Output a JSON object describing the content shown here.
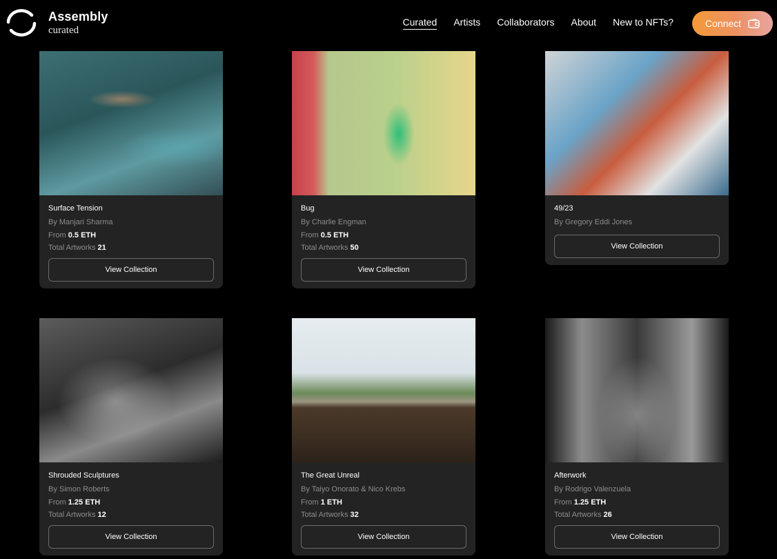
{
  "header": {
    "brand_title": "Assembly",
    "brand_sub": "curated",
    "nav": [
      {
        "label": "Curated",
        "active": true
      },
      {
        "label": "Artists",
        "active": false
      },
      {
        "label": "Collaborators",
        "active": false
      },
      {
        "label": "About",
        "active": false
      },
      {
        "label": "New to NFTs?",
        "active": false
      }
    ],
    "connect_label": "Connect",
    "connect_icon": "wallet-icon"
  },
  "labels": {
    "from": "From",
    "total_artworks": "Total Artworks",
    "view_collection": "View Collection"
  },
  "collections": [
    {
      "title": "Surface Tension",
      "artist": "By Manjari Sharma",
      "price": "0.5 ETH",
      "total": "21"
    },
    {
      "title": "Bug",
      "artist": "By Charlie Engman",
      "price": "0.5 ETH",
      "total": "50"
    },
    {
      "title": "49/23",
      "artist": "By Gregory Eddi Jones",
      "price": "",
      "total": ""
    },
    {
      "title": "Shrouded Sculptures",
      "artist": "By Simon Roberts",
      "price": "1.25 ETH",
      "total": "12"
    },
    {
      "title": "The Great Unreal",
      "artist": "By Taiyo Onorato & Nico Krebs",
      "price": "1 ETH",
      "total": "32"
    },
    {
      "title": "Afterwork",
      "artist": "By Rodrigo Valenzuela",
      "price": "1.25 ETH",
      "total": "26"
    }
  ],
  "colors": {
    "background": "#000000",
    "card": "#232323",
    "connect_gradient_start": "#f39a38",
    "connect_gradient_end": "#e8a6a0"
  }
}
